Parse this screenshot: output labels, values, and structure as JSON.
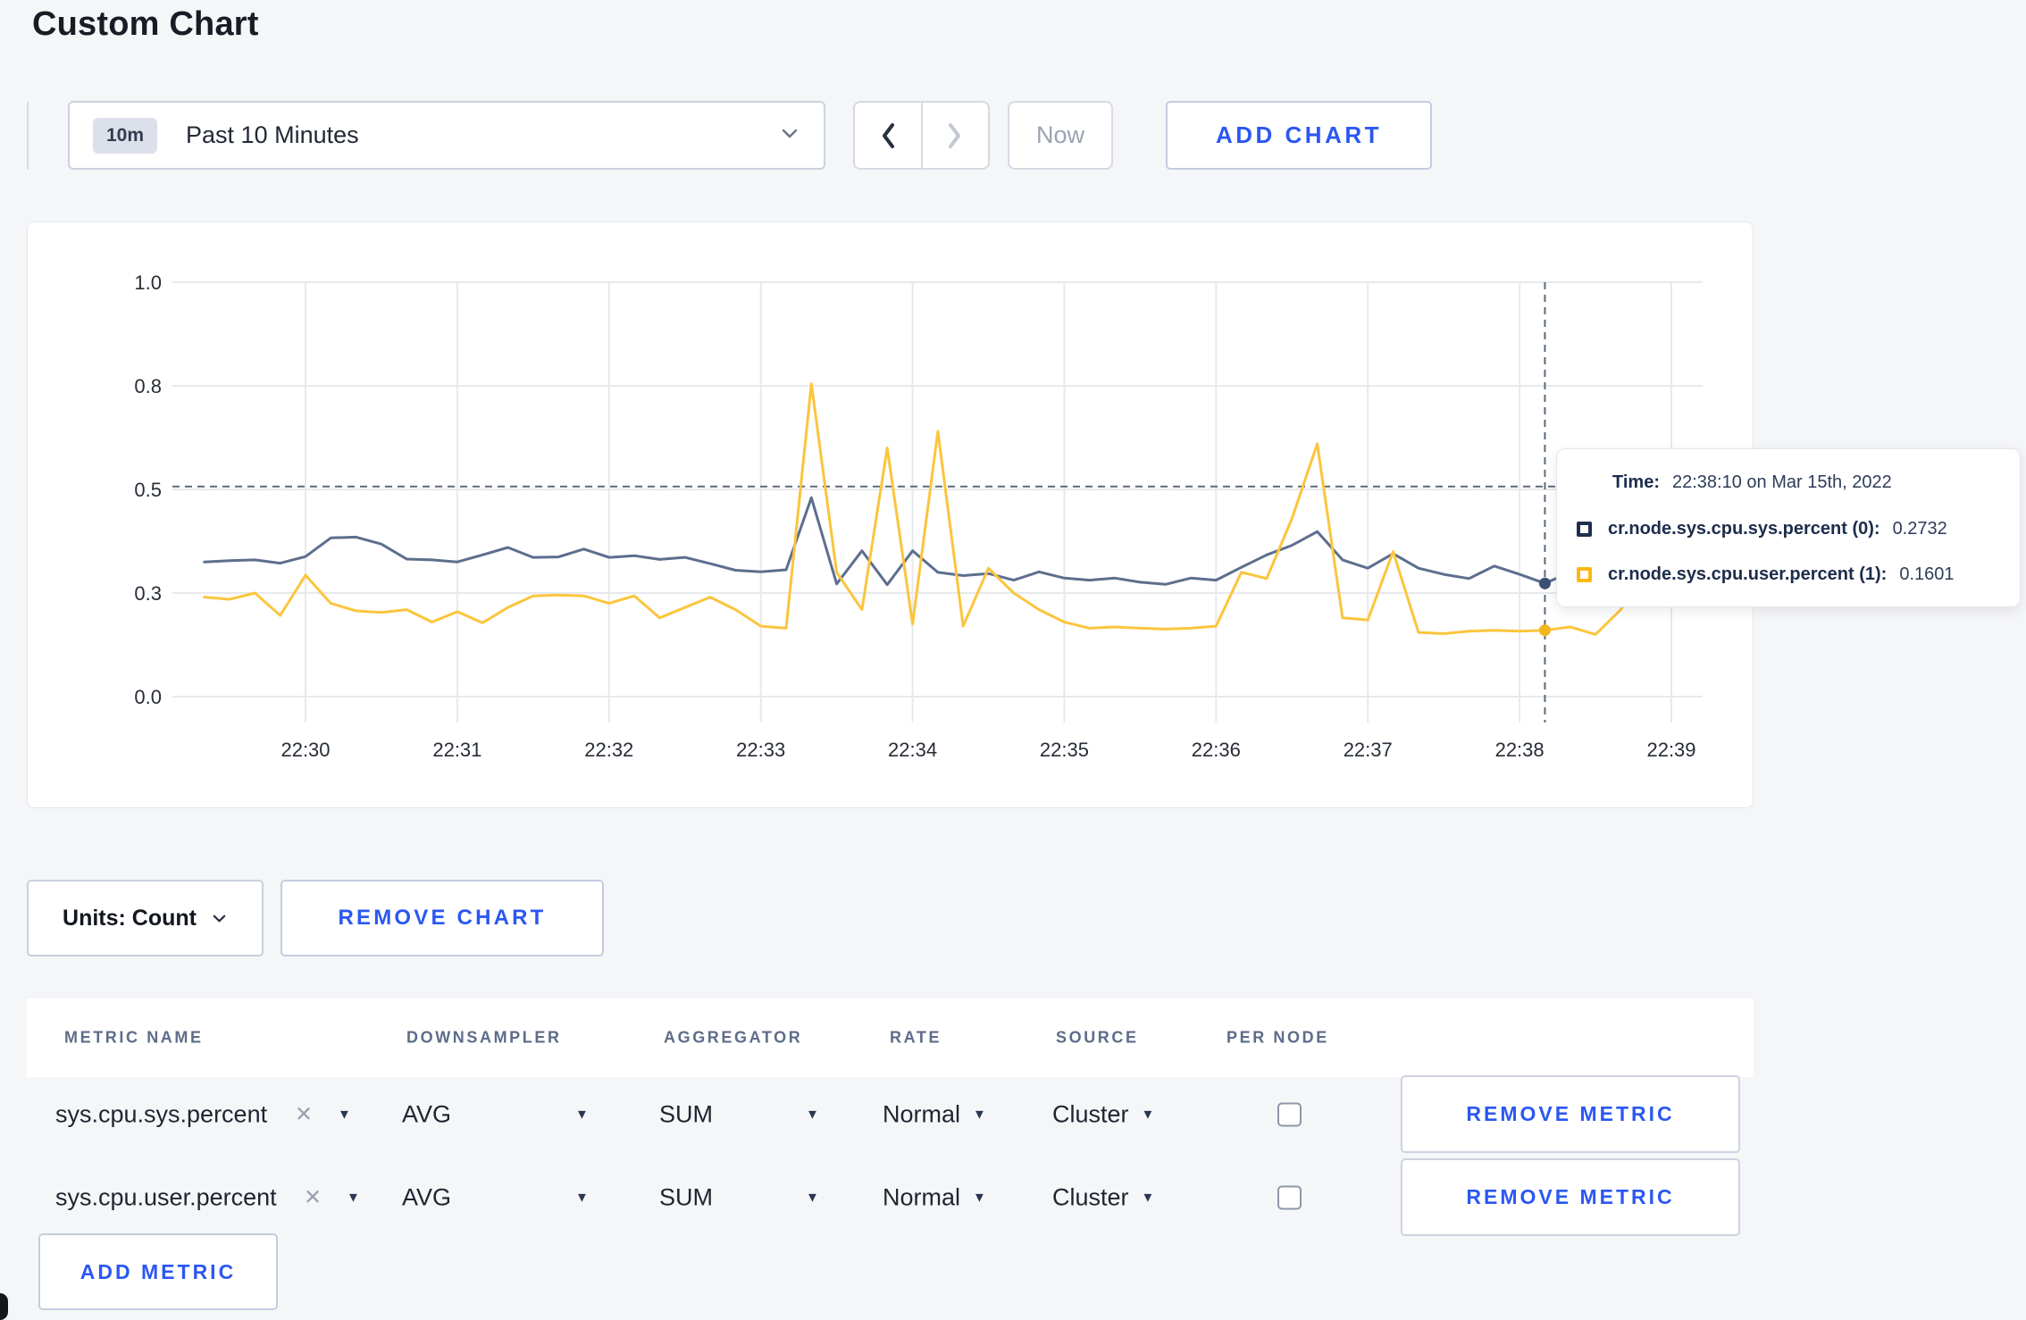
{
  "page": {
    "title": "Custom Chart",
    "background": "#f5f6f8",
    "accent_blue": "#2b57f2"
  },
  "toolbar": {
    "time_range": {
      "badge": "10m",
      "label": "Past 10 Minutes"
    },
    "now_label": "Now",
    "add_chart_label": "ADD CHART"
  },
  "chart": {
    "units_label": "Units: Count",
    "remove_chart_label": "REMOVE CHART",
    "tooltip": {
      "time_label": "Time:",
      "time_value": "22:38:10 on Mar 15th, 2022",
      "rows": [
        {
          "label": "cr.node.sys.cpu.sys.percent (0):",
          "value": "0.2732"
        },
        {
          "label": "cr.node.sys.cpu.user.percent (1):",
          "value": "0.1601"
        }
      ]
    }
  },
  "chart_data": {
    "type": "line",
    "title": "",
    "xlabel": "",
    "ylabel": "",
    "ylim": [
      0,
      1
    ],
    "grid": true,
    "legend_position": "hover-tooltip",
    "x_start_time": "22:29:20",
    "start_offset_seconds": 10,
    "interval_seconds": 10,
    "y_ticks": [
      {
        "label": "0.0",
        "value": 0
      },
      {
        "label": "0.3",
        "value": 0.25
      },
      {
        "label": "0.5",
        "value": 0.5
      },
      {
        "label": "0.8",
        "value": 0.75
      },
      {
        "label": "1.0",
        "value": 1.0
      }
    ],
    "x_ticks": [
      {
        "label": "22:30",
        "t": 50
      },
      {
        "label": "22:31",
        "t": 110
      },
      {
        "label": "22:32",
        "t": 170
      },
      {
        "label": "22:33",
        "t": 230
      },
      {
        "label": "22:34",
        "t": 290
      },
      {
        "label": "22:35",
        "t": 350
      },
      {
        "label": "22:36",
        "t": 410
      },
      {
        "label": "22:37",
        "t": 470
      },
      {
        "label": "22:38",
        "t": 530
      },
      {
        "label": "22:39",
        "t": 590
      }
    ],
    "series": [
      {
        "name": "cr.node.sys.cpu.sys.percent",
        "color": "#5d6e8e",
        "swatch": "#1e2f51",
        "values": [
          0.325,
          0.328,
          0.33,
          0.322,
          0.338,
          0.383,
          0.385,
          0.368,
          0.332,
          0.33,
          0.325,
          0.342,
          0.36,
          0.336,
          0.337,
          0.356,
          0.336,
          0.34,
          0.331,
          0.336,
          0.321,
          0.305,
          0.301,
          0.306,
          0.48,
          0.272,
          0.352,
          0.27,
          0.352,
          0.3,
          0.292,
          0.297,
          0.281,
          0.301,
          0.286,
          0.281,
          0.286,
          0.276,
          0.271,
          0.286,
          0.281,
          0.312,
          0.342,
          0.365,
          0.398,
          0.33,
          0.31,
          0.345,
          0.31,
          0.295,
          0.285,
          0.315,
          0.295,
          0.2732,
          0.3,
          0.315,
          0.3,
          0.295,
          0.3,
          0.305
        ]
      },
      {
        "name": "cr.node.sys.cpu.user.percent",
        "color": "#fbc53d",
        "swatch": "#fdb813",
        "values": [
          0.24,
          0.235,
          0.25,
          0.196,
          0.293,
          0.225,
          0.207,
          0.203,
          0.21,
          0.18,
          0.205,
          0.178,
          0.215,
          0.243,
          0.245,
          0.243,
          0.225,
          0.243,
          0.19,
          0.215,
          0.24,
          0.21,
          0.17,
          0.165,
          0.755,
          0.3,
          0.21,
          0.6,
          0.175,
          0.64,
          0.17,
          0.31,
          0.25,
          0.21,
          0.18,
          0.165,
          0.168,
          0.165,
          0.163,
          0.165,
          0.17,
          0.3,
          0.285,
          0.43,
          0.61,
          0.19,
          0.185,
          0.35,
          0.155,
          0.152,
          0.158,
          0.16,
          0.158,
          0.1601,
          0.168,
          0.15,
          0.21,
          0.295,
          0.3,
          0.24
        ]
      }
    ],
    "hover": {
      "time": "22:38:10",
      "t_seconds": 540,
      "hline_value": 0.507,
      "points": [
        {
          "series": "cr.node.sys.cpu.sys.percent",
          "value": 0.2732,
          "color": "#3e4f73"
        },
        {
          "series": "cr.node.sys.cpu.user.percent",
          "value": 0.1601,
          "color": "#f3b71e"
        }
      ]
    }
  },
  "metrics_table": {
    "headers": [
      "METRIC NAME",
      "DOWNSAMPLER",
      "AGGREGATOR",
      "RATE",
      "SOURCE",
      "PER NODE"
    ],
    "rows": [
      {
        "metric": "sys.cpu.sys.percent",
        "downsampler": "AVG",
        "aggregator": "SUM",
        "rate": "Normal",
        "source": "Cluster",
        "per_node_checked": false,
        "remove_label": "REMOVE METRIC"
      },
      {
        "metric": "sys.cpu.user.percent",
        "downsampler": "AVG",
        "aggregator": "SUM",
        "rate": "Normal",
        "source": "Cluster",
        "per_node_checked": false,
        "remove_label": "REMOVE METRIC"
      }
    ],
    "add_metric_label": "ADD METRIC"
  }
}
